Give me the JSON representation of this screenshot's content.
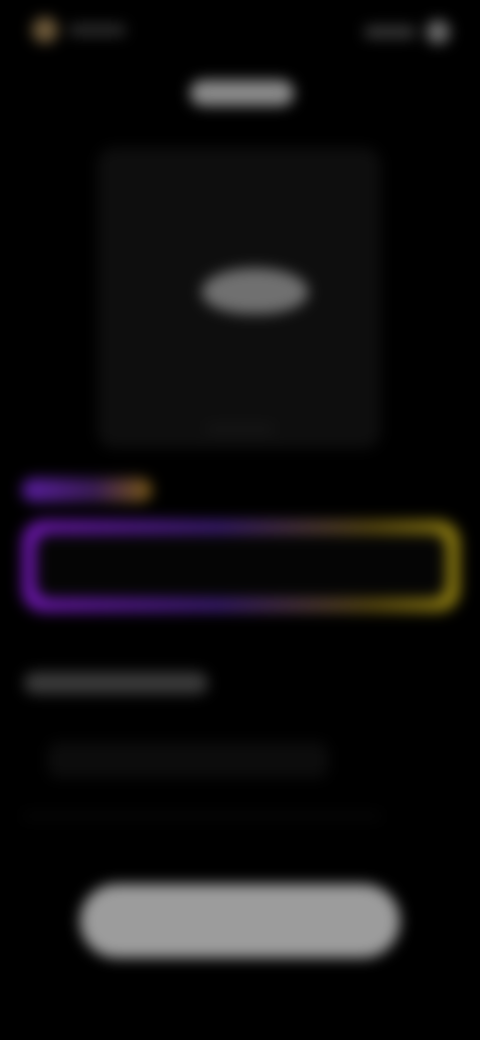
{
  "header": {
    "left_icon": "avatar-icon",
    "right_icon": "profile-icon"
  },
  "preview": {
    "icon": "cloud-icon"
  },
  "prompt": {
    "value": "",
    "placeholder": ""
  },
  "primary_action": {
    "label": ""
  },
  "colors": {
    "background": "#000000",
    "accent_purple": "#6a16a8",
    "accent_gold": "#8a7a10",
    "button": "#9c9c9c"
  }
}
